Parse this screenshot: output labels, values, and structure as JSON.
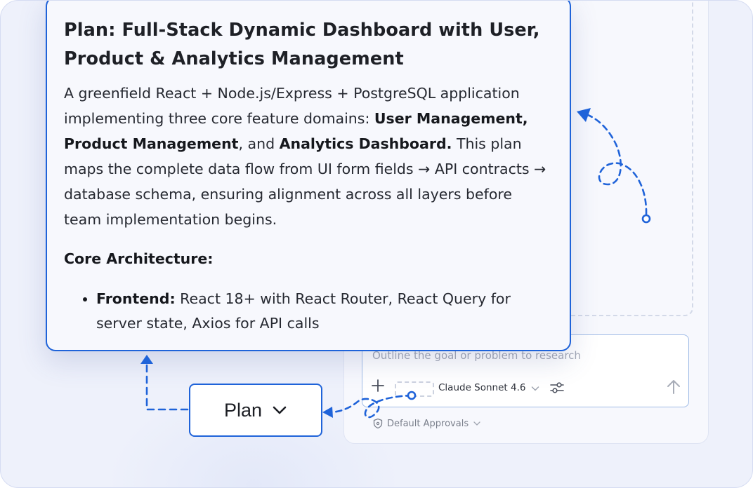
{
  "plan": {
    "title": "Plan: Full-Stack Dynamic Dashboard with User, Product & Analytics Management",
    "desc_intro": "A greenfield React + Node.js/Express + PostgreSQL application implementing three core feature domains: ",
    "desc_bold1": "User Management, Product Management",
    "desc_sep": ", and ",
    "desc_bold2": "Analytics Dashboard.",
    "desc_rest": " This plan maps the complete data flow from UI form fields → API contracts → database schema, ensuring alignment across all layers before team implementation begins.",
    "architecture_heading": "Core Architecture:",
    "architecture_items": [
      {
        "label": "Frontend:",
        "text": " React 18+ with React Router, React Query for server state, Axios for API calls"
      }
    ]
  },
  "mode_button": {
    "label": "Plan"
  },
  "composer": {
    "placeholder": "Outline the goal or problem to research",
    "model": "Claude Sonnet 4.6"
  },
  "approvals": {
    "label": "Default Approvals"
  },
  "colors": {
    "accent": "#1f63d9",
    "background": "#eef1fb",
    "card": "#f7f8fd"
  },
  "icons": [
    "plus-icon",
    "chevron-down-icon",
    "settings-sliders-icon",
    "arrow-up-icon",
    "shield-icon"
  ]
}
